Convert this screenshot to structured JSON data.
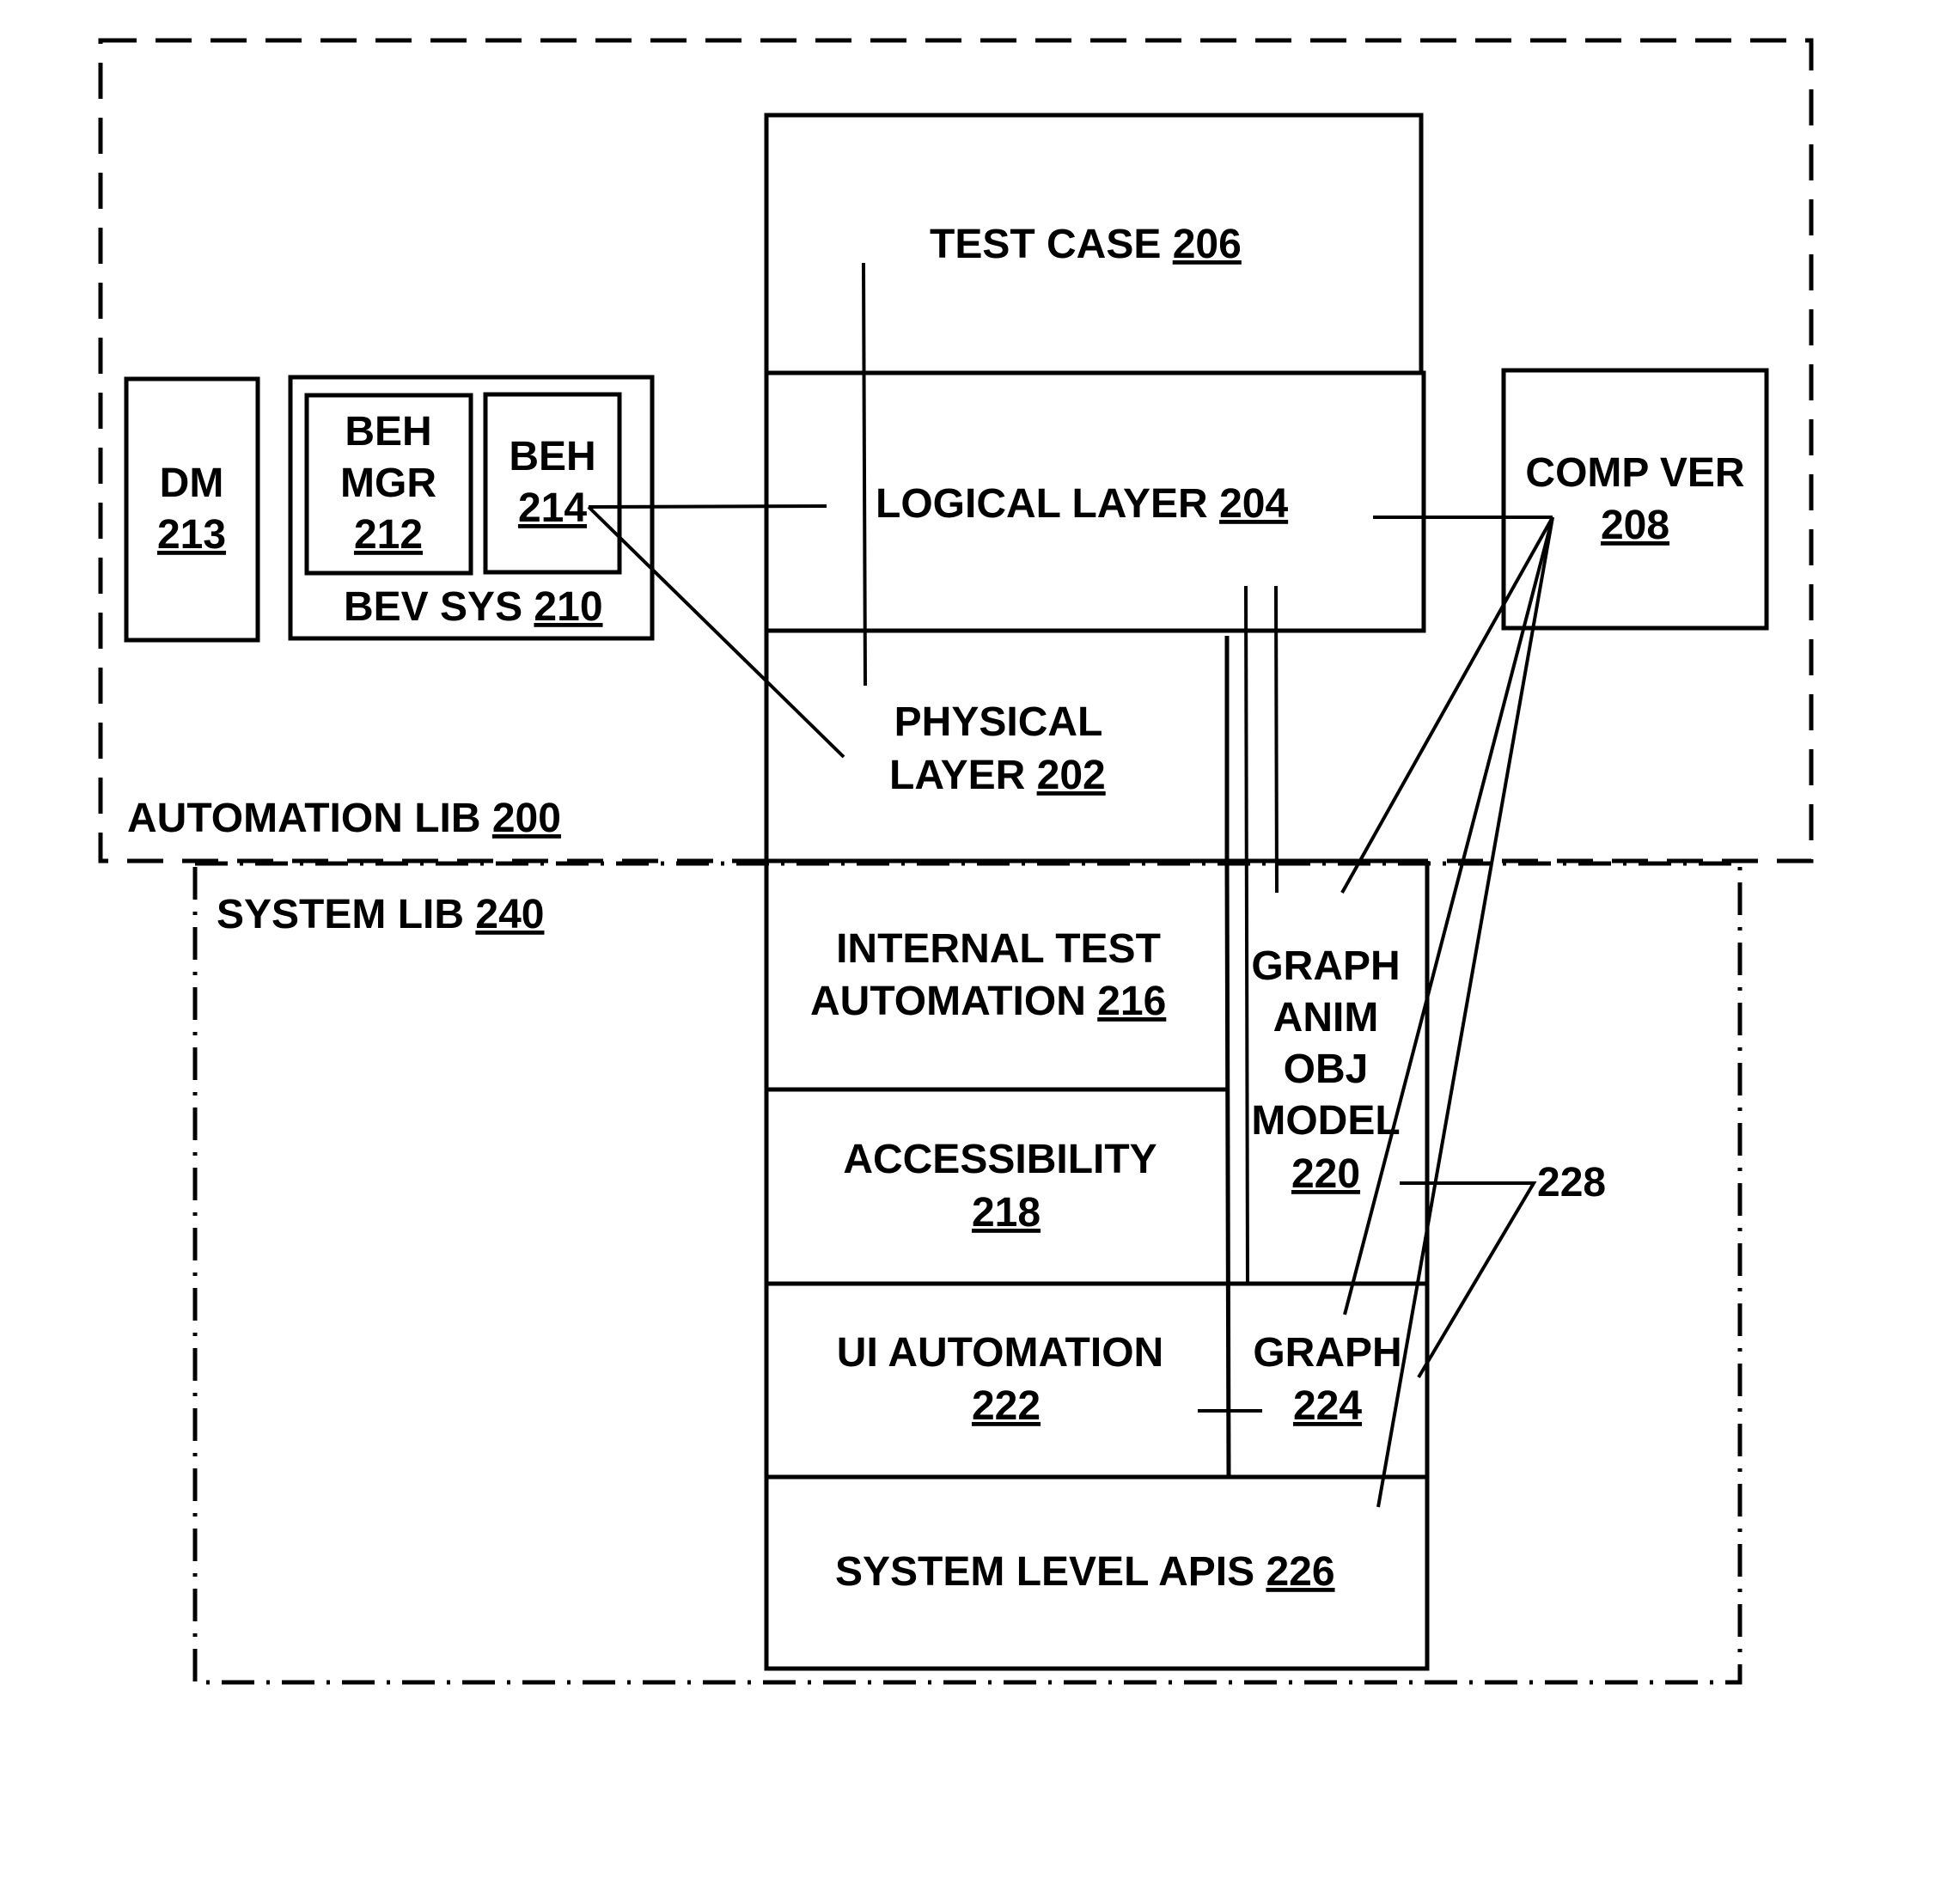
{
  "colors": {
    "ink": "#000000",
    "background": "#ffffff"
  },
  "containers": {
    "automation_lib": {
      "label": "AUTOMATION LIB",
      "ref": "200",
      "style": "dashed"
    },
    "system_lib": {
      "label": "SYSTEM LIB",
      "ref": "240",
      "style": "dash-dot"
    }
  },
  "blocks": {
    "dm": {
      "lines": [
        "DM"
      ],
      "ref": "213"
    },
    "bev_sys": {
      "label": "BEV SYS",
      "ref": "210"
    },
    "beh_mgr": {
      "lines": [
        "BEH",
        "MGR"
      ],
      "ref": "212"
    },
    "beh": {
      "lines": [
        "BEH"
      ],
      "ref": "214"
    },
    "test_case": {
      "label": "TEST CASE",
      "ref": "206"
    },
    "logical_layer": {
      "label": "LOGICAL LAYER",
      "ref": "204"
    },
    "physical_layer": {
      "lines": [
        "PHYSICAL",
        "LAYER"
      ],
      "ref": "202"
    },
    "comp_ver": {
      "lines": [
        "COMP VER"
      ],
      "ref": "208"
    },
    "internal_test_automation": {
      "lines": [
        "INTERNAL TEST",
        "AUTOMATION"
      ],
      "ref": "216"
    },
    "accessibility": {
      "lines": [
        "ACCESSIBILITY"
      ],
      "ref": "218"
    },
    "ui_automation": {
      "lines": [
        "UI AUTOMATION"
      ],
      "ref": "222"
    },
    "graph_anim_obj_model": {
      "lines": [
        "GRAPH",
        "ANIM",
        "OBJ",
        "MODEL"
      ],
      "ref": "220"
    },
    "graph": {
      "lines": [
        "GRAPH"
      ],
      "ref": "224"
    },
    "system_level_apis": {
      "label": "SYSTEM LEVEL APIS",
      "ref": "226"
    }
  },
  "callouts": {
    "interfaces": "228"
  }
}
